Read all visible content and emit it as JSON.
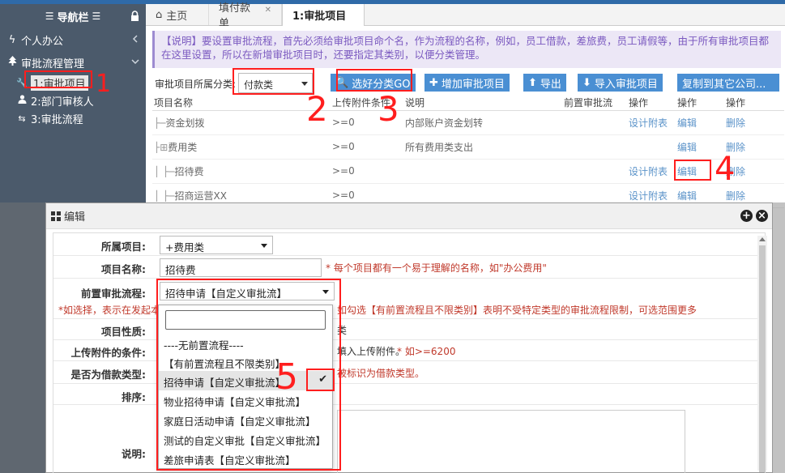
{
  "sidebar": {
    "title": "导航栏",
    "groups": [
      {
        "label": "个人办公",
        "icon": "bolt-icon"
      },
      {
        "label": "审批流程管理",
        "icon": "tree-icon"
      }
    ],
    "items": [
      {
        "label": "1:审批项目",
        "icon": "wrench-icon"
      },
      {
        "label": "2:部门审核人",
        "icon": "user-icon"
      },
      {
        "label": "3:审批流程",
        "icon": "retweet-icon"
      }
    ]
  },
  "tabs": [
    {
      "label": "主页"
    },
    {
      "label": "填付款单"
    },
    {
      "label": "1:审批项目"
    }
  ],
  "notice": "【说明】要设置审批流程，首先必须给审批项目命个名，作为流程的名称，例如，员工借款，差旅费，员工请假等，由于所有审批项目都在这里设置，所以在新增审批项目时，还要指定其类别，以便分类管理。",
  "toolbar": {
    "category_label": "审批项目所属分类:",
    "category_value": "付款类",
    "btn_filter": "选好分类GO",
    "btn_add": "增加审批项目",
    "btn_export": "导出",
    "btn_import": "导入审批项目",
    "btn_copy": "复制到其它公司..."
  },
  "grid": {
    "headers": [
      "项目名称",
      "上传附件条件",
      "说明",
      "前置审批流",
      "操作",
      "操作",
      "操作"
    ],
    "rows": [
      {
        "name": "资金划拨",
        "cond": ">=0",
        "desc": "内部账户资金划转",
        "pre": "",
        "op1": "设计附表",
        "op2": "编辑",
        "op3": "删除"
      },
      {
        "name": "费用类",
        "cond": ">=0",
        "desc": "所有费用类支出",
        "pre": "",
        "op1": "",
        "op2": "编辑",
        "op3": "删除"
      },
      {
        "name": "招待费",
        "cond": ">=0",
        "desc": "",
        "pre": "",
        "op1": "设计附表",
        "op2": "编辑",
        "op3": "删除"
      },
      {
        "name": "招商运营XX",
        "cond": ">=0",
        "desc": "",
        "pre": "",
        "op1": "设计附表",
        "op2": "编辑",
        "op3": "删除"
      }
    ]
  },
  "modal": {
    "title": "编辑",
    "labels": {
      "parent": "所属项目:",
      "name": "项目名称:",
      "pre_flow": "前置审批流程:",
      "nature": "项目性质:",
      "upload_cond": "上传附件的条件:",
      "is_loan": "是否为借款类型:",
      "order": "排序:",
      "desc": "说明:"
    },
    "parent_value": "+费用类",
    "name_value": "招待费",
    "name_hint": "* 每个项目都有一个易于理解的名称，如\"办公费用\"",
    "pre_flow_value": "招待申请【自定义审批流】",
    "pre_hint_left": "*如选择，表示在发起本",
    "pre_hint_right": "如勾选【有前置流程且不限类别】表明不受特定类型的审批流程限制，可选范围更多",
    "nature_tail": "类",
    "upload_tail": "填入上传附件。",
    "upload_hint": "* 如>=6200",
    "loan_tail": "被标识为借款类型。"
  },
  "dropdown": {
    "options": [
      "----无前置流程----",
      "【有前置流程且不限类别】",
      "招待申请【自定义审批流】",
      "物业招待申请【自定义审批流】",
      "家庭日活动申请【自定义审批流】",
      "测试的自定义审批【自定义审批流】",
      "差旅申请表【自定义审批流】"
    ],
    "selected_index": 2
  },
  "annotations": [
    "1",
    "2",
    "3",
    "4",
    "5"
  ],
  "colors": {
    "accent": "#4a8fd3",
    "sidebar": "#4b5a6b",
    "annotation": "#ff1e1e"
  }
}
